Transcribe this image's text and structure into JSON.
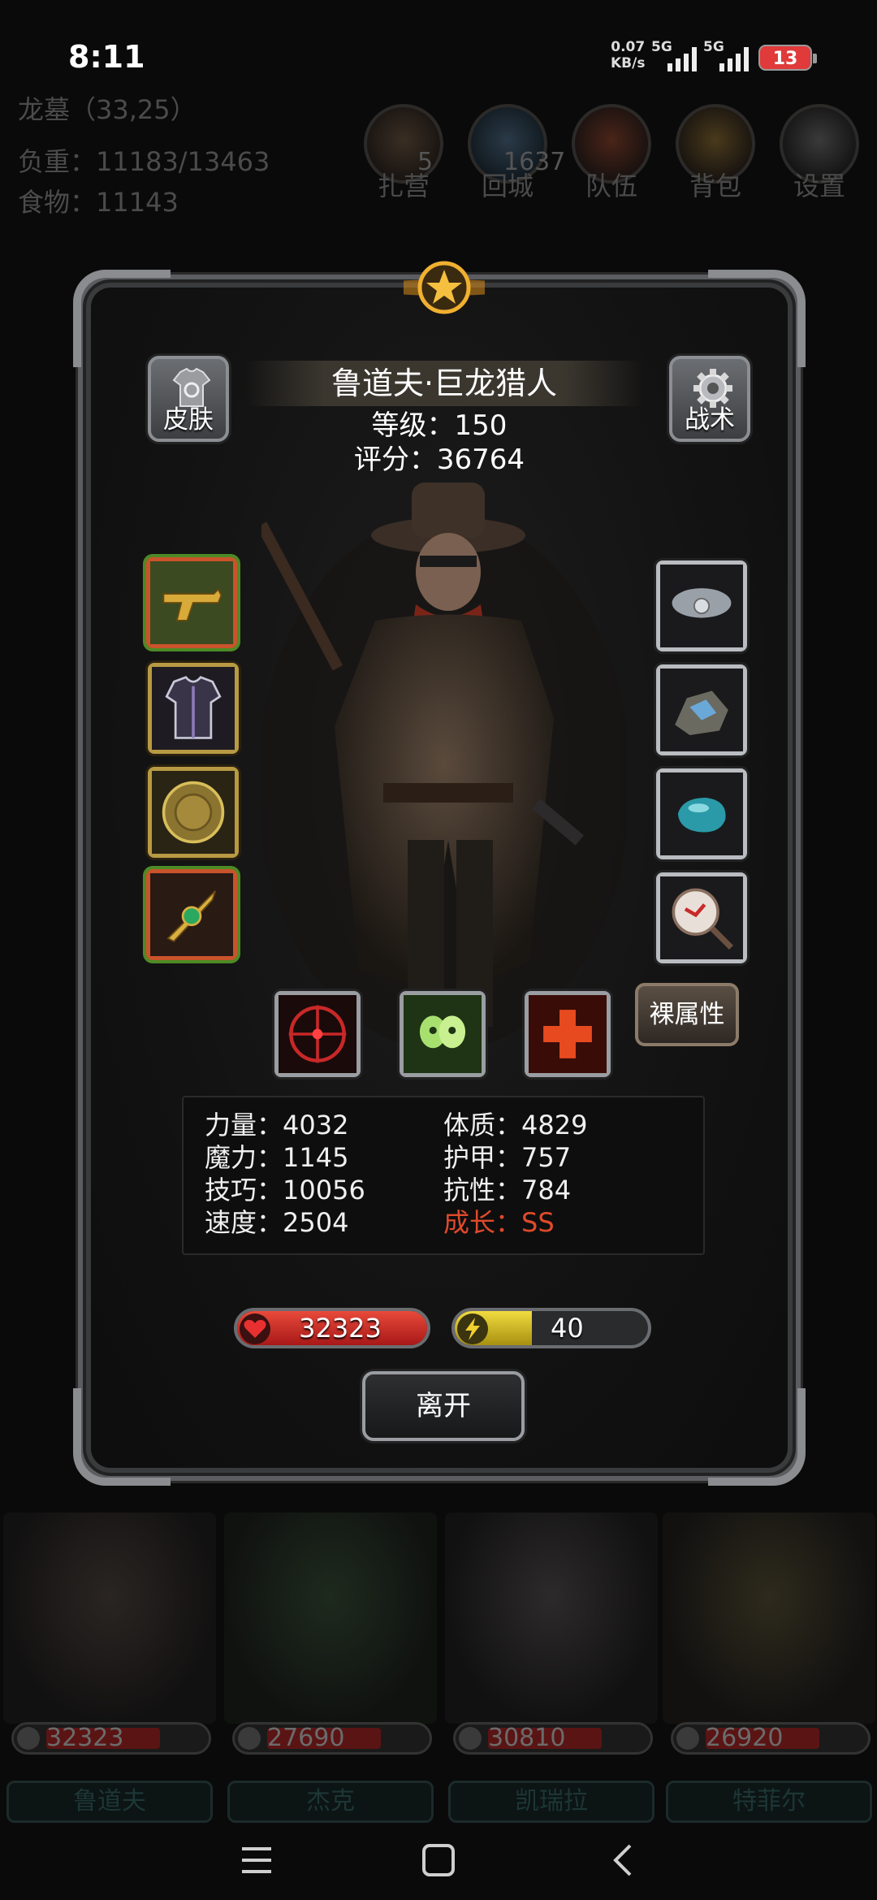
{
  "status_bar": {
    "time": "8:11",
    "net_speed_value": "0.07",
    "net_speed_unit": "KB/s",
    "signal1_label": "5G",
    "signal2_label": "5G",
    "battery": "13"
  },
  "background": {
    "location": "龙墓（33,25）",
    "load": "负重：11183/13463",
    "food": "食物：11143",
    "menu": [
      {
        "label": "扎营",
        "badge": "5"
      },
      {
        "label": "回城",
        "badge": "1637"
      },
      {
        "label": "队伍",
        "badge": ""
      },
      {
        "label": "背包",
        "badge": ""
      },
      {
        "label": "设置",
        "badge": ""
      }
    ]
  },
  "character": {
    "name": "鲁道夫·巨龙猎人",
    "level": "等级：150",
    "score": "评分：36764",
    "skin_label": "皮肤",
    "tactics_label": "战术",
    "naked_stats_label": "裸属性",
    "stats": {
      "strength": "力量：4032",
      "magic": "魔力：1145",
      "skill": "技巧：10056",
      "speed": "速度：2504",
      "constitution": "体质：4829",
      "armor": "护甲：757",
      "resistance": "抗性：784",
      "growth": "成长：SS"
    },
    "hp": "32323",
    "hp_fill": 1.0,
    "energy": "40",
    "energy_fill": 0.4,
    "leave_label": "离开"
  },
  "team": [
    {
      "hp": "32323",
      "name": "鲁道夫"
    },
    {
      "hp": "27690",
      "name": "杰克"
    },
    {
      "hp": "30810",
      "name": "凯瑞拉"
    },
    {
      "hp": "26920",
      "name": "特菲尔"
    }
  ],
  "colors": {
    "hp_red": "#d62222",
    "energy_yellow": "#d6c020",
    "growth_red": "#e04a2a"
  }
}
